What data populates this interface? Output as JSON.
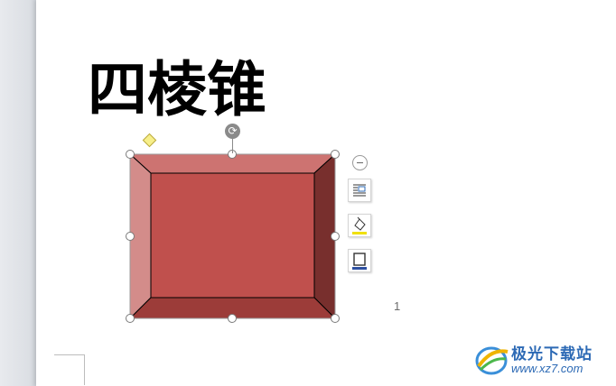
{
  "document": {
    "title": "四棱锥",
    "page_number": "1"
  },
  "shape": {
    "name": "bevel",
    "fill": "#c0504d",
    "top_face": "#cd7371",
    "left_face": "#d38c8a",
    "right_face": "#782f2d",
    "bottom_face": "#9c3c39",
    "outline": "#000000"
  },
  "float_toolbar": {
    "collapse_icon": "minus-circle-icon",
    "items": [
      {
        "icon": "wrap-text-icon"
      },
      {
        "icon": "fill-color-icon"
      },
      {
        "icon": "outline-icon"
      }
    ]
  },
  "watermark": {
    "title": "极光下载站",
    "url": "www.xz7.com",
    "color": "#2d6ab5"
  }
}
